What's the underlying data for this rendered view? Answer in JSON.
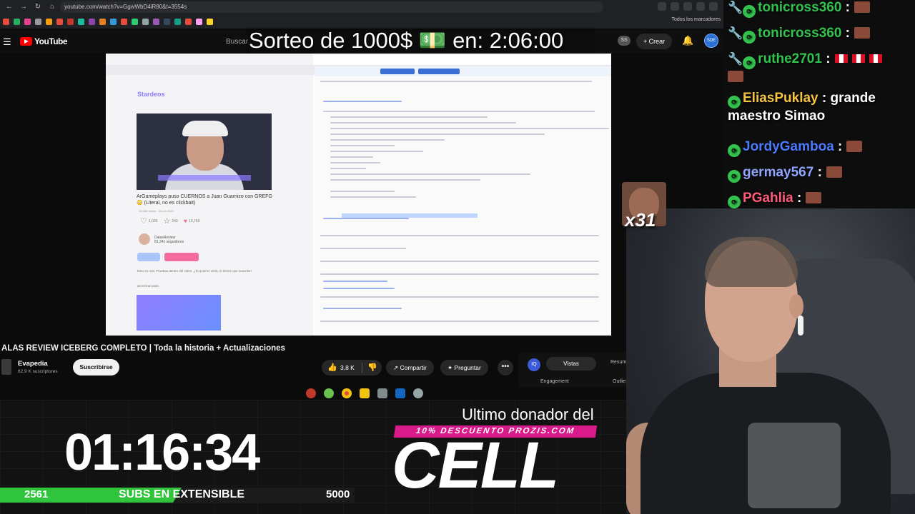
{
  "browser": {
    "url": "youtube.com/watch?v=GgwWbD4iR80&t=3554s",
    "bookmarks_right_label": "Todos los marcadores"
  },
  "youtube": {
    "logo_text": "YouTube",
    "search_placeholder": "Buscar",
    "ss_badge": "SS",
    "create_label": "Crear",
    "avatar_text": "SDE"
  },
  "overlay_giveaway": {
    "text": "Sorteo de 1000$ 💵 en:  2:06:00"
  },
  "video": {
    "site_logo": "Stardeos",
    "title": "ArGameplays puso CUERNOS a Juan Guarnizo con GREFG 😳 (Literal, no es clickbait)",
    "meta": "15,088 visitas · 26 jun 2022",
    "rating_1": "1,026",
    "rating_2": "243",
    "rating_3": "16,769",
    "channel": "DalasReview",
    "channel_subs": "81,241 seguidores",
    "description": "Esto es real. Pruebas dentro del video. ¿Si quieres verla, lo tienes que suscribir!",
    "show_more": "MOSTRAR MÁS"
  },
  "watch": {
    "title": "ALAS REVIEW ICEBERG COMPLETO | Toda la historia + Actualizaciones",
    "channel": "Evapedia",
    "subs": "62,9 K suscriptores",
    "subscribe": "Suscribirse",
    "likes": "3,8 K",
    "share": "Compartir",
    "ask": "Preguntar",
    "more": "•••",
    "panel_icon": "IQ",
    "panel_tab": "Vistas",
    "panel_summary": "Resum",
    "panel_engagement": "Engagement",
    "panel_outlier": "Outlie"
  },
  "stream_overlay": {
    "timer": "01:16:34",
    "subs_current": "2561",
    "subs_label": "SUBS EN EXTENSIBLE",
    "subs_goal": "5000",
    "subs_progress": 0.5122,
    "last_donor_label": "Ultimo donador del",
    "sponsor": "10% DESCUENTO PROZIS.COM",
    "last_donor_name": "CELL",
    "emote_count": "x31"
  },
  "chat": [
    {
      "user": "tonicross360",
      "text": "",
      "color": "#32c24d"
    },
    {
      "user": "tonicross360",
      "text": "",
      "color": "#32c24d"
    },
    {
      "user": "ruthe2701",
      "text": "",
      "color": "#32c24d"
    },
    {
      "user": "EliasPuklay",
      "text": "grande",
      "cont": "maestro Simao",
      "color": "#f5c542"
    },
    {
      "user": "JordyGamboa",
      "text": "",
      "color": "#4a7bff"
    },
    {
      "user": "germay567",
      "text": "",
      "color": "#8fa6ff"
    },
    {
      "user": "PGahlia",
      "text": "",
      "color": "#ff5a7a"
    }
  ],
  "colors": {
    "youtube_red": "#ff0000",
    "progress_green": "#2fc43b",
    "sponsor_pink": "#d91a8a"
  }
}
